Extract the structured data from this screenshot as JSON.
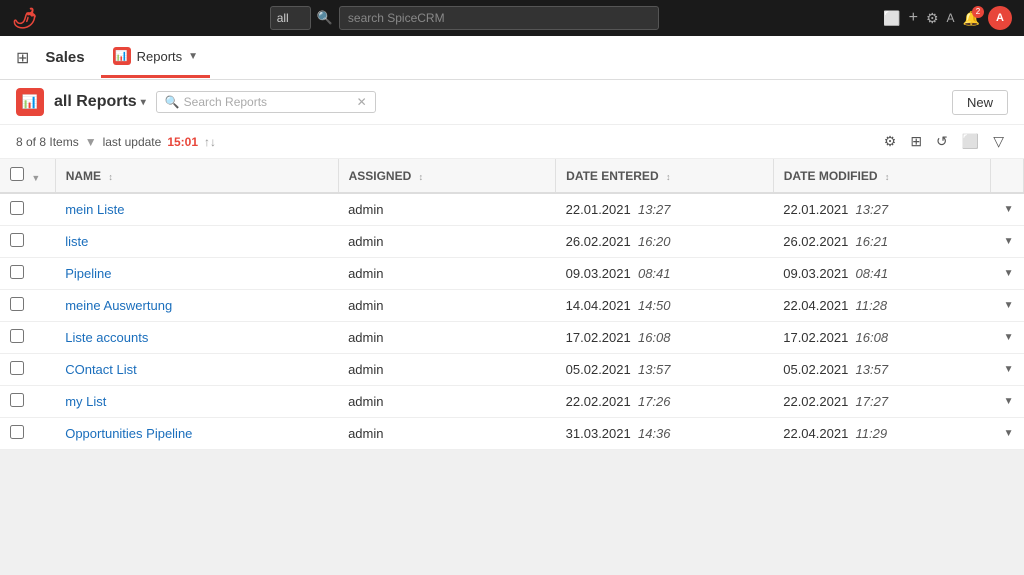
{
  "topbar": {
    "logo": "🌶",
    "search_placeholder": "search SpiceCRM",
    "select_options": [
      "all"
    ],
    "select_value": "all",
    "icons": {
      "expand": "⬜",
      "add": "+",
      "settings": "⚙",
      "text": "A",
      "notification": "🔔",
      "notification_count": "2",
      "avatar_initials": "A"
    }
  },
  "navbar": {
    "app_title": "Sales",
    "tab_label": "Reports",
    "tab_icon": "📊"
  },
  "page": {
    "module_icon": "📊",
    "title": "all Reports",
    "search_placeholder": "Search Reports",
    "new_button_label": "New"
  },
  "subheader": {
    "items_count": "8 of 8 Items",
    "last_update_label": "last update",
    "last_update_time": "15:01"
  },
  "table": {
    "columns": [
      {
        "id": "checkbox",
        "label": ""
      },
      {
        "id": "name",
        "label": "NAME"
      },
      {
        "id": "assigned",
        "label": "ASSIGNED"
      },
      {
        "id": "date_entered",
        "label": "DATE ENTERED"
      },
      {
        "id": "date_modified",
        "label": "DATE MODIFIED"
      },
      {
        "id": "action",
        "label": ""
      }
    ],
    "rows": [
      {
        "name": "mein Liste",
        "assigned": "admin",
        "date_entered": "22.01.2021",
        "date_entered_time": "13:27",
        "date_modified": "22.01.2021",
        "date_modified_time": "13:27"
      },
      {
        "name": "liste",
        "assigned": "admin",
        "date_entered": "26.02.2021",
        "date_entered_time": "16:20",
        "date_modified": "26.02.2021",
        "date_modified_time": "16:21"
      },
      {
        "name": "Pipeline",
        "assigned": "admin",
        "date_entered": "09.03.2021",
        "date_entered_time": "08:41",
        "date_modified": "09.03.2021",
        "date_modified_time": "08:41"
      },
      {
        "name": "meine Auswertung",
        "assigned": "admin",
        "date_entered": "14.04.2021",
        "date_entered_time": "14:50",
        "date_modified": "22.04.2021",
        "date_modified_time": "11:28"
      },
      {
        "name": "Liste accounts",
        "assigned": "admin",
        "date_entered": "17.02.2021",
        "date_entered_time": "16:08",
        "date_modified": "17.02.2021",
        "date_modified_time": "16:08"
      },
      {
        "name": "COntact List",
        "assigned": "admin",
        "date_entered": "05.02.2021",
        "date_entered_time": "13:57",
        "date_modified": "05.02.2021",
        "date_modified_time": "13:57"
      },
      {
        "name": "my List",
        "assigned": "admin",
        "date_entered": "22.02.2021",
        "date_entered_time": "17:26",
        "date_modified": "22.02.2021",
        "date_modified_time": "17:27"
      },
      {
        "name": "Opportunities Pipeline",
        "assigned": "admin",
        "date_entered": "31.03.2021",
        "date_entered_time": "14:36",
        "date_modified": "22.04.2021",
        "date_modified_time": "11:29"
      }
    ]
  }
}
